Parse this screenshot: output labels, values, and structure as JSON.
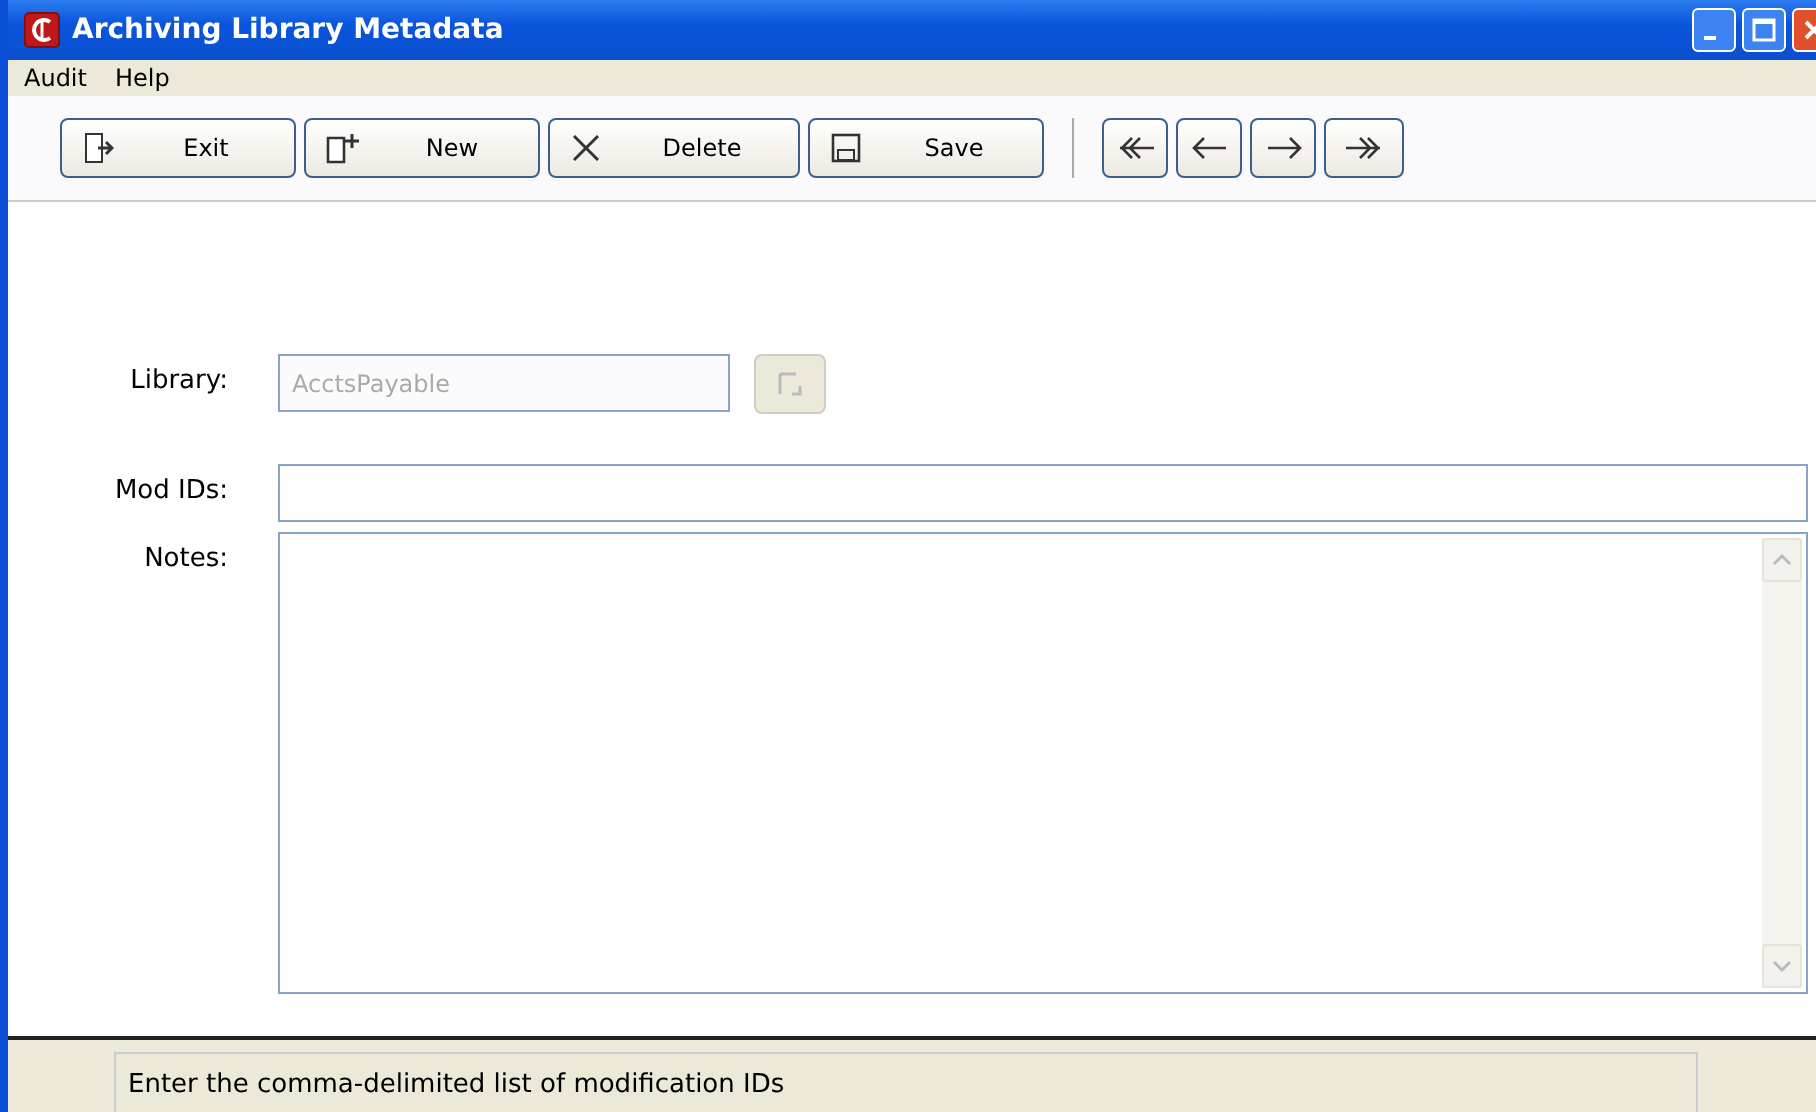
{
  "window": {
    "title": "Archiving Library Metadata"
  },
  "menu": [
    "Audit",
    "Help"
  ],
  "toolbar": [
    {
      "kind": "exit",
      "label": "Exit"
    },
    {
      "kind": "new",
      "label": "New"
    },
    {
      "kind": "delete",
      "label": "Delete"
    },
    {
      "kind": "save",
      "label": "Save"
    }
  ],
  "navigation": [
    {
      "kind": "first"
    },
    {
      "kind": "prev"
    },
    {
      "kind": "next"
    },
    {
      "kind": "last"
    }
  ],
  "form": {
    "library": {
      "label": "Library:",
      "value": "AcctsPayable",
      "disabled": true
    },
    "mod_ids": {
      "label": "Mod IDs:"
    },
    "notes": {
      "label": "Notes:"
    }
  },
  "status_bar": "Enter the comma-delimited list of modification IDs"
}
